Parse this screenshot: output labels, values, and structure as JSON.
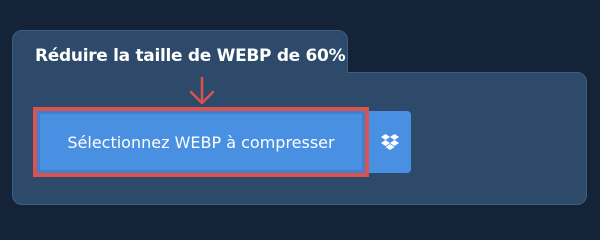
{
  "tab": {
    "title": "Réduire la taille de WEBP de 60%"
  },
  "upload": {
    "label": "Sélectionnez WEBP à compresser"
  },
  "icons": {
    "arrow": "arrow-down-icon",
    "dropbox": "dropbox-icon"
  },
  "colors": {
    "background": "#142338",
    "panel": "#2d4a6b",
    "button": "#4a90e2",
    "highlight": "#d9534f"
  }
}
